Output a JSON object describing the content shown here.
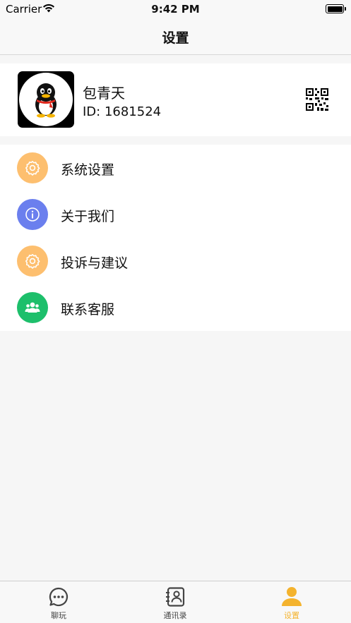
{
  "status_bar": {
    "carrier": "Carrier",
    "time": "9:42 PM"
  },
  "nav": {
    "title": "设置"
  },
  "profile": {
    "name": "包青天",
    "id_text": "ID: 1681524"
  },
  "menu": {
    "items": [
      {
        "label": "系统设置",
        "icon": "gear-icon",
        "color": "#fdbf6f"
      },
      {
        "label": "关于我们",
        "icon": "info-icon",
        "color": "#6b7fee"
      },
      {
        "label": "投诉与建议",
        "icon": "gear-icon",
        "color": "#fdbf6f"
      },
      {
        "label": "联系客服",
        "icon": "people-icon",
        "color": "#1dbf6b"
      }
    ]
  },
  "tabs": [
    {
      "label": "聊玩",
      "icon": "chat-icon",
      "active": false
    },
    {
      "label": "通讯录",
      "icon": "contacts-icon",
      "active": false
    },
    {
      "label": "设置",
      "icon": "user-icon",
      "active": true
    }
  ],
  "colors": {
    "accent": "#f4b32e",
    "background": "#f6f6f6"
  }
}
